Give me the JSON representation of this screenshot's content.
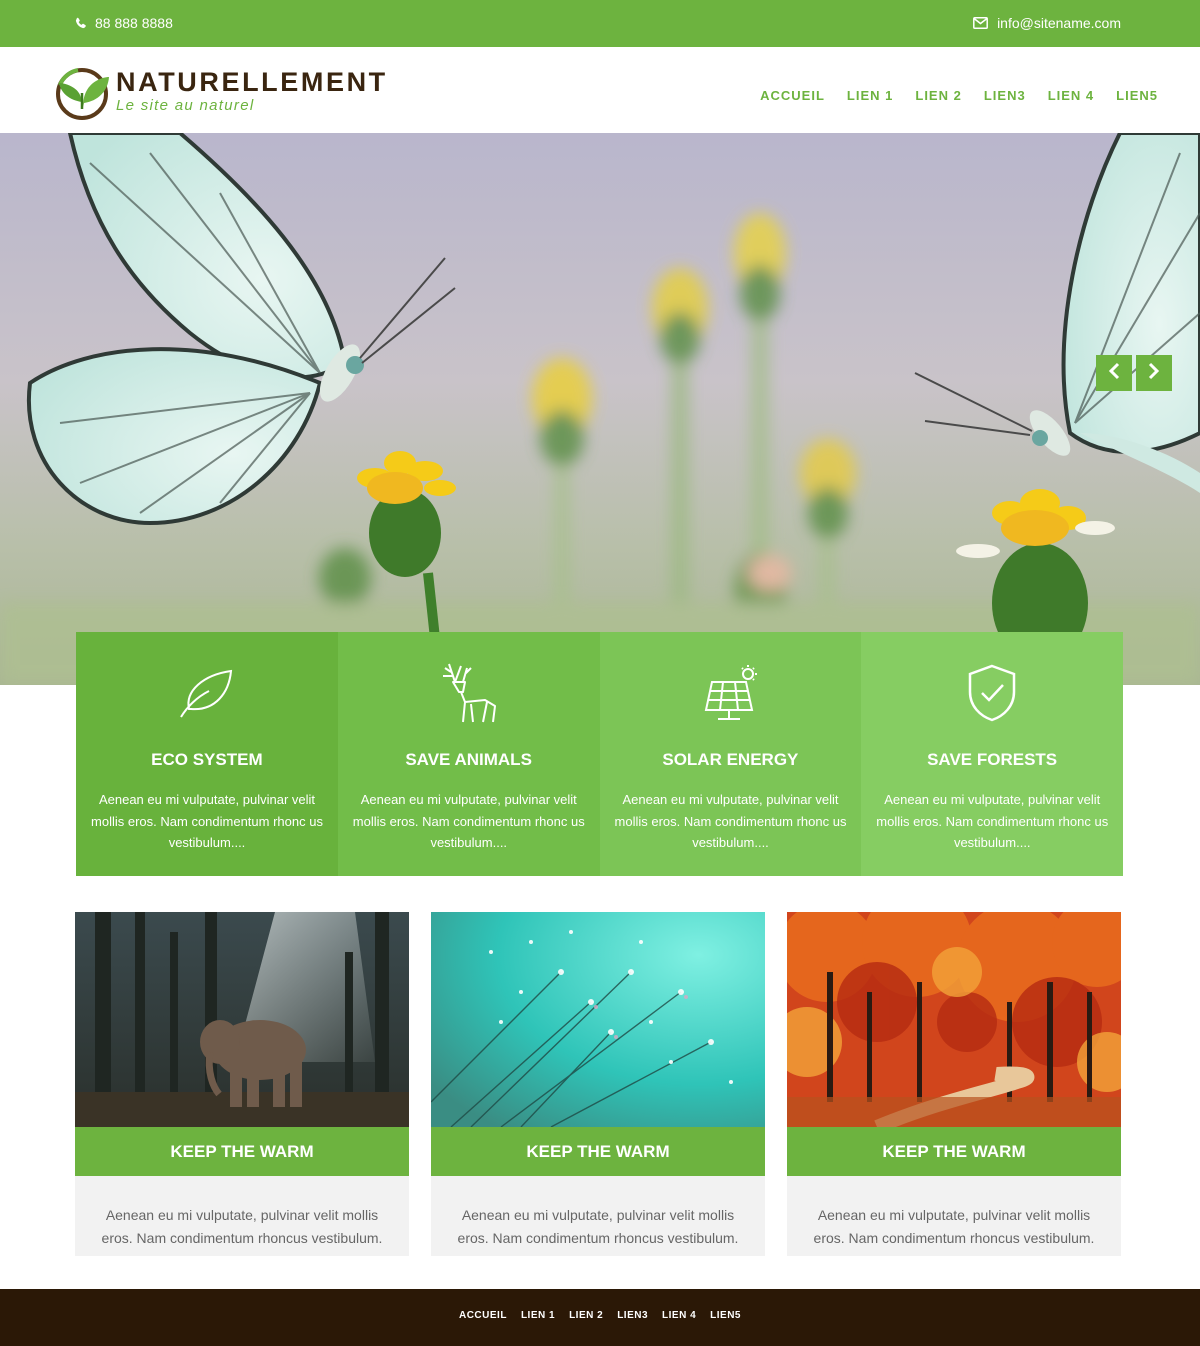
{
  "topbar": {
    "phone": "88 888 8888",
    "phone_icon": "phone-icon",
    "email": "info@sitename.com",
    "email_icon": "envelope-icon",
    "bg_color": "#6db33f"
  },
  "logo": {
    "name": "NATURELLEMENT",
    "tagline": "Le site au naturel",
    "icon": "leaf-logo-icon"
  },
  "nav": {
    "items": [
      "ACCUEIL",
      "LIEN 1",
      "LIEN 2",
      "LIEN3",
      "LIEN 4",
      "LIEN5"
    ]
  },
  "hero": {
    "prev_icon": "chevron-left-icon",
    "next_icon": "chevron-right-icon"
  },
  "features": [
    {
      "icon": "leaf-icon",
      "title": "ECO SYSTEM",
      "text": "Aenean eu mi vulputate, pulvinar velit mollis eros. Nam condimentum rhonc us vestibulum....",
      "bg": "#68b23c"
    },
    {
      "icon": "deer-icon",
      "title": "SAVE ANIMALS",
      "text": "Aenean eu mi vulputate, pulvinar velit mollis eros. Nam condimentum rhonc us vestibulum....",
      "bg": "#72bd49"
    },
    {
      "icon": "solar-panel-icon",
      "title": "SOLAR ENERGY",
      "text": "Aenean eu mi vulputate, pulvinar velit mollis eros. Nam condimentum rhonc us vestibulum....",
      "bg": "#7cc556"
    },
    {
      "icon": "shield-check-icon",
      "title": "SAVE FORESTS",
      "text": "Aenean eu mi vulputate, pulvinar velit mollis eros. Nam condimentum rhonc us vestibulum....",
      "bg": "#86cd62"
    }
  ],
  "cards": [
    {
      "image": "elephant-forest-image",
      "title": "KEEP THE WARM",
      "text": "Aenean eu mi vulputate, pulvinar velit mollis eros. Nam condimentum rhoncus vestibulum."
    },
    {
      "image": "dandelion-dew-image",
      "title": "KEEP THE WARM",
      "text": "Aenean eu mi vulputate, pulvinar velit mollis eros. Nam condimentum rhoncus vestibulum."
    },
    {
      "image": "autumn-forest-image",
      "title": "KEEP THE WARM",
      "text": "Aenean eu mi vulputate, pulvinar velit mollis eros. Nam condimentum rhoncus vestibulum."
    }
  ],
  "footer": {
    "items": [
      "ACCUEIL",
      "LIEN 1",
      "LIEN 2",
      "LIEN3",
      "LIEN 4",
      "LIEN5"
    ],
    "bg_color": "#2b1806"
  }
}
